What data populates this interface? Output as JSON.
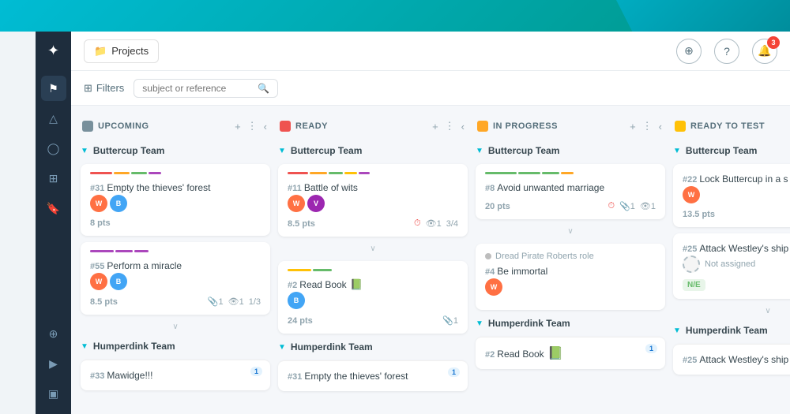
{
  "bg": {
    "topColor": "#26c6da",
    "sidebarColor": "#1e2d3d"
  },
  "header": {
    "projects_label": "Projects",
    "folder_icon": "📁",
    "nav_icon": "⊕",
    "help_icon": "?",
    "notification_icon": "🔔",
    "notification_count": "3"
  },
  "toolbar": {
    "filter_label": "Filters",
    "search_placeholder": "subject or reference"
  },
  "sidebar": {
    "logo": "✦",
    "items": [
      {
        "id": "nav1",
        "icon": "⚑"
      },
      {
        "id": "nav2",
        "icon": "△"
      },
      {
        "id": "nav3",
        "icon": "◯"
      },
      {
        "id": "nav4",
        "icon": "▦"
      },
      {
        "id": "nav5",
        "icon": "🔖"
      }
    ],
    "bottom_items": [
      {
        "id": "sb1",
        "icon": "⊕"
      },
      {
        "id": "sb2",
        "icon": "🎬"
      },
      {
        "id": "sb3",
        "icon": "▣"
      }
    ]
  },
  "board": {
    "columns": [
      {
        "id": "upcoming",
        "title": "UPCOMING",
        "color": "#78909c"
      },
      {
        "id": "ready",
        "title": "READY",
        "color": "#ef5350"
      },
      {
        "id": "in_progress",
        "title": "IN PROGRESS",
        "color": "#ffa726"
      },
      {
        "id": "ready_to_test",
        "title": "READY TO TEST",
        "color": "#ffc107"
      }
    ],
    "team_buttercup": "Buttercup Team",
    "team_humperdink": "Humperdink Team",
    "cards": {
      "upcoming_1": {
        "id": "#31",
        "title": "Empty the thieves' forest",
        "pts": "8 pts",
        "color_bars": [
          "#ef5350",
          "#ffa726",
          "#66bb6a",
          "#ab47bc"
        ],
        "avatars": [
          "#ff7043",
          "#42a5f5"
        ]
      },
      "upcoming_2": {
        "id": "#55",
        "title": "Perform a miracle",
        "pts": "8.5 pts",
        "color_bars": [
          "#ab47bc",
          "#ab47bc",
          "#ab47bc"
        ],
        "meta_clip": "1",
        "meta_eye": "1",
        "meta_fraction": "1/3",
        "avatars": [
          "#ff7043",
          "#42a5f5"
        ]
      },
      "ready_1": {
        "id": "#11",
        "title": "Battle of wits",
        "pts": "8.5 pts",
        "color_bars": [
          "#ef5350",
          "#ffa726",
          "#66bb6a",
          "#ffc107",
          "#ab47bc"
        ],
        "meta_eye": "1",
        "meta_fraction": "3/4",
        "avatars": [
          "#ff7043",
          "#9c27b0"
        ]
      },
      "ready_2": {
        "id": "#2",
        "title": "Read Book",
        "pts": "24 pts",
        "color_bars": [
          "#ffc107",
          "#66bb6a"
        ],
        "meta_clip": "1",
        "emoji": "📗",
        "avatars": [
          "#42a5f5"
        ]
      },
      "in_progress_1": {
        "id": "#8",
        "title": "Avoid unwanted marriage",
        "pts": "20 pts",
        "color_bars": [
          "#66bb6a",
          "#66bb6a",
          "#66bb6a",
          "#ffa726"
        ],
        "meta_clip": "1",
        "meta_eye": "1",
        "avatars": []
      },
      "in_progress_2": {
        "id": "#4",
        "title": "Be immortal",
        "role": "Dread Pirate Roberts role",
        "pts": "",
        "avatars": [
          "#ff7043"
        ]
      },
      "ready_to_test_1": {
        "id": "#22",
        "title": "Lock Buttercup in a s",
        "pts": "13.5 pts",
        "color_bars": [],
        "avatars": [
          "#ff7043"
        ]
      },
      "ready_to_test_2": {
        "id": "#25",
        "title": "Attack Westley's ship",
        "pts": "",
        "not_assigned": "Not assigned",
        "ne_badge": "N/E",
        "avatars": []
      }
    },
    "bottom_cards": {
      "upcoming_hump": {
        "id": "#33",
        "title": "Mawidge!!!",
        "count": "1"
      },
      "ready_hump": {
        "id": "#31",
        "title": "Empty the thieves' forest",
        "count": "1"
      },
      "in_progress_hump": {
        "id": "#2",
        "title": "Read Book",
        "count": "1",
        "emoji": "📗"
      },
      "ready_to_test_hump": {
        "id": "#25",
        "title": "Attack Westley's ship",
        "count": ""
      }
    }
  }
}
